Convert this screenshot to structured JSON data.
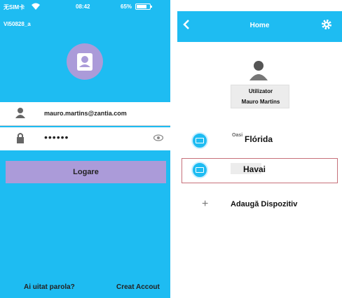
{
  "left_screen": {
    "status_bar": {
      "carrier": "无SIM卡",
      "time": "08:42",
      "battery_pct": "65%"
    },
    "ssid": "VI50828_a",
    "username_field": {
      "value": "mauro.martins@zantia.com"
    },
    "password_field": {
      "value": "••••••"
    },
    "login_button": "Logare",
    "forgot_password_link": "Ai uitat parola?",
    "create_account_link": "Creat Accout"
  },
  "right_screen": {
    "nav": {
      "title": "Home"
    },
    "user": {
      "line1": "Utilizator",
      "line2": "Mauro Martins"
    },
    "devices": [
      {
        "tag": "Oasi",
        "name": "Flórida"
      },
      {
        "name": "Havai"
      }
    ],
    "add_device": "Adaugă Dispozitiv"
  },
  "colors": {
    "accent": "#1ebcf2",
    "button": "#ab9bd9"
  }
}
